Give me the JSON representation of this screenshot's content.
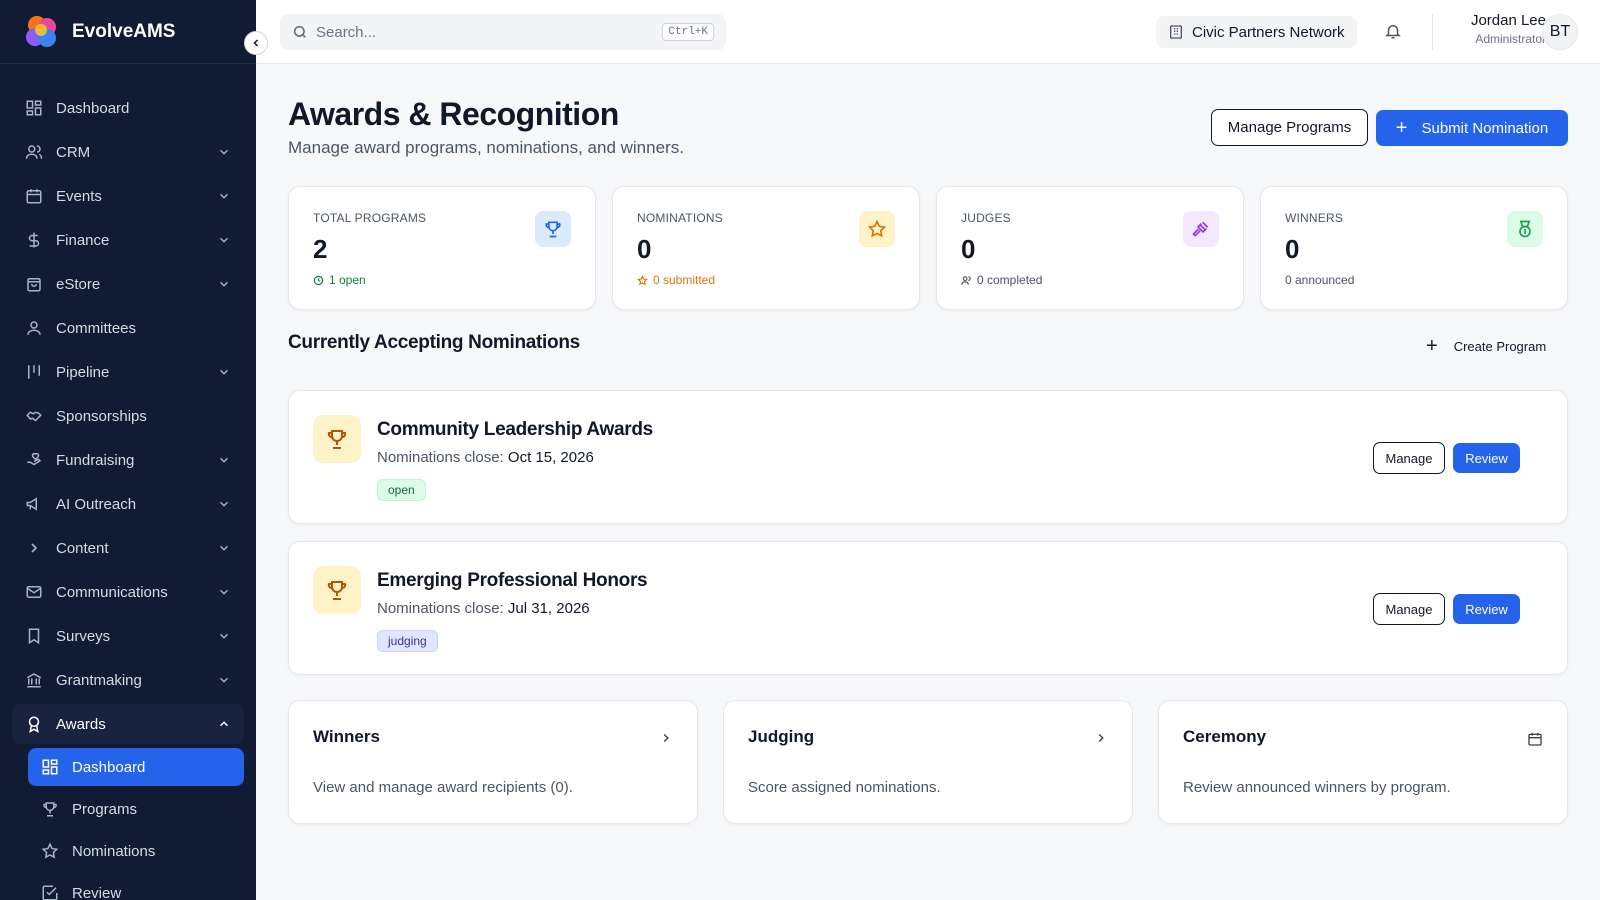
{
  "app": {
    "name": "EvolveAMS"
  },
  "sidebar": {
    "items": [
      {
        "label": "Dashboard",
        "icon": "grid-icon",
        "chevron": false
      },
      {
        "label": "CRM",
        "icon": "users-icon",
        "chevron": true
      },
      {
        "label": "Events",
        "icon": "calendar-icon",
        "chevron": true
      },
      {
        "label": "Finance",
        "icon": "dollar-icon",
        "chevron": true
      },
      {
        "label": "eStore",
        "icon": "shopping-bag-icon",
        "chevron": true
      },
      {
        "label": "Committees",
        "icon": "user-group-icon",
        "chevron": false
      },
      {
        "label": "Pipeline",
        "icon": "kanban-icon",
        "chevron": true
      },
      {
        "label": "Sponsorships",
        "icon": "handshake-icon",
        "chevron": false
      },
      {
        "label": "Fundraising",
        "icon": "hand-heart-icon",
        "chevron": true
      },
      {
        "label": "AI Outreach",
        "icon": "megaphone-icon",
        "chevron": true
      },
      {
        "label": "Content",
        "icon": "chevron-right-icon",
        "chevron": true
      },
      {
        "label": "Communications",
        "icon": "mail-icon",
        "chevron": true
      },
      {
        "label": "Surveys",
        "icon": "bookmark-icon",
        "chevron": true
      },
      {
        "label": "Grantmaking",
        "icon": "bank-icon",
        "chevron": true
      }
    ],
    "awards": {
      "label": "Awards",
      "icon": "award-icon",
      "subitems": [
        {
          "label": "Dashboard",
          "icon": "grid-icon"
        },
        {
          "label": "Programs",
          "icon": "trophy-icon"
        },
        {
          "label": "Nominations",
          "icon": "star-icon"
        },
        {
          "label": "Review",
          "icon": "check-square-icon"
        }
      ]
    }
  },
  "topbar": {
    "search_placeholder": "Search...",
    "search_shortcut": "Ctrl+K",
    "org_name": "Civic Partners Network",
    "user_name": "Jordan Lee",
    "user_role": "Administrator",
    "avatar_initials": "BT"
  },
  "page": {
    "title": "Awards & Recognition",
    "subtitle": "Manage award programs, nominations, and winners.",
    "manage_programs_label": "Manage Programs",
    "submit_nomination_label": "Submit Nomination",
    "plus_glyph": "+"
  },
  "stats": [
    {
      "label": "TOTAL PROGRAMS",
      "value": "2",
      "foot": "1 open",
      "foot_color": "#15803d",
      "icon": "trophy-icon",
      "icon_bg": "#dbeafe",
      "icon_color": "#2563eb"
    },
    {
      "label": "NOMINATIONS",
      "value": "0",
      "foot": "0 submitted",
      "foot_color": "#d97706",
      "icon": "star-icon",
      "icon_bg": "#fef3c7",
      "icon_color": "#d97706"
    },
    {
      "label": "JUDGES",
      "value": "0",
      "foot": "0 completed",
      "foot_color": "#4b5563",
      "icon": "gavel-icon",
      "icon_bg": "#f3e8ff",
      "icon_color": "#9333ea"
    },
    {
      "label": "WINNERS",
      "value": "0",
      "foot": "0 announced",
      "foot_color": "#4b5563",
      "icon": "medal-icon",
      "icon_bg": "#dcfce7",
      "icon_color": "#16a34a"
    }
  ],
  "section": {
    "title": "Currently Accepting Nominations",
    "create_program_label": "Create Program"
  },
  "programs": [
    {
      "name": "Community Leadership Awards",
      "close_label": "Nominations close:",
      "close_date": "Oct 15, 2026",
      "status": "open",
      "manage_label": "Manage",
      "review_label": "Review"
    },
    {
      "name": "Emerging Professional Honors",
      "close_label": "Nominations close:",
      "close_date": "Jul 31, 2026",
      "status": "judging",
      "manage_label": "Manage",
      "review_label": "Review"
    }
  ],
  "links": [
    {
      "title": "Winners",
      "desc": "View and manage award recipients (0).",
      "icon": "chevron-right-icon"
    },
    {
      "title": "Judging",
      "desc": "Score assigned nominations.",
      "icon": "chevron-right-icon"
    },
    {
      "title": "Ceremony",
      "desc": "Review announced winners by program.",
      "icon": "calendar-icon"
    }
  ],
  "colors": {
    "sidebar_bg": "#111b33",
    "accent": "#2563eb",
    "page_bg": "#f7f8fa"
  }
}
